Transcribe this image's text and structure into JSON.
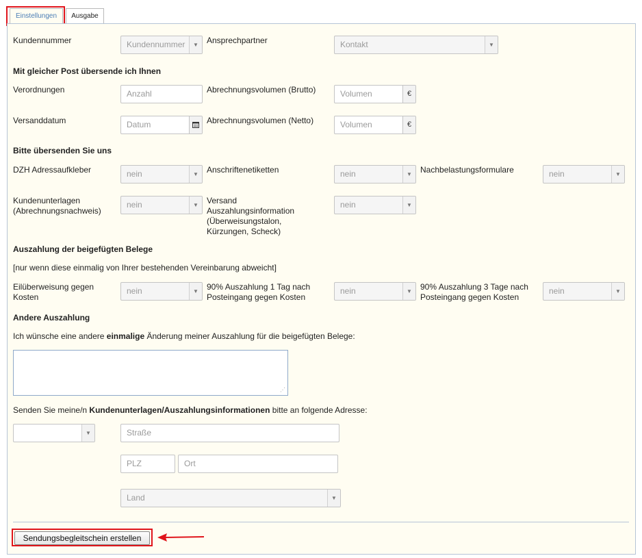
{
  "tabs": [
    {
      "label": "Einstellungen"
    },
    {
      "label": "Ausgabe"
    }
  ],
  "row1": {
    "kundennummer_label": "Kundennummer",
    "kundennummer_select": "Kundennummer",
    "ansprechpartner_label": "Ansprechpartner",
    "kontakt_select": "Kontakt"
  },
  "post": {
    "heading": "Mit gleicher Post übersende ich Ihnen",
    "verordnungen_label": "Verordnungen",
    "anzahl_placeholder": "Anzahl",
    "brutto_label": "Abrechnungsvolumen (Brutto)",
    "volumen_placeholder": "Volumen",
    "versanddatum_label": "Versanddatum",
    "datum_placeholder": "Datum",
    "netto_label": "Abrechnungsvolumen (Netto)",
    "currency": "€"
  },
  "send": {
    "heading": "Bitte übersenden Sie uns",
    "dzh_label": "DZH Adressaufkleber",
    "anschriften_label": "Anschriftenetiketten",
    "nachbelastung_label": "Nachbelastungsformulare",
    "kundenunterlagen_label": "Kundenunterlagen (Abrechnungsnachweis)",
    "versand_label": "Versand Auszahlungsinformation (Überweisungstalon, Kürzungen, Scheck)",
    "no": "nein"
  },
  "payout": {
    "heading": "Auszahlung der beigefügten Belege",
    "note": "[nur wenn diese einmalig von Ihrer bestehenden Vereinbarung abweicht]",
    "eil_label": "Eilüberweisung gegen Kosten",
    "p1_label": "90% Auszahlung 1 Tag nach Posteingang gegen Kosten",
    "p3_label": "90% Auszahlung 3 Tage nach Posteingang gegen Kosten"
  },
  "other": {
    "heading": "Andere Auszahlung",
    "text_pre": "Ich wünsche eine andere ",
    "text_bold": "einmalige",
    "text_post": " Änderung meiner Auszahlung für die beigefügten Belege:",
    "textarea_value": ""
  },
  "address": {
    "text_pre": "Senden Sie meine/n ",
    "text_bold": "Kundenunterlagen/Auszahlungsinformationen",
    "text_post": " bitte an folgende Adresse:",
    "salutation_select": "",
    "strasse_placeholder": "Straße",
    "plz_placeholder": "PLZ",
    "ort_placeholder": "Ort",
    "land_select": "Land"
  },
  "submit_label": "Sendungsbegleitschein erstellen",
  "colors": {
    "highlight": "#e0141b",
    "active_tab": "#4a7db5"
  }
}
